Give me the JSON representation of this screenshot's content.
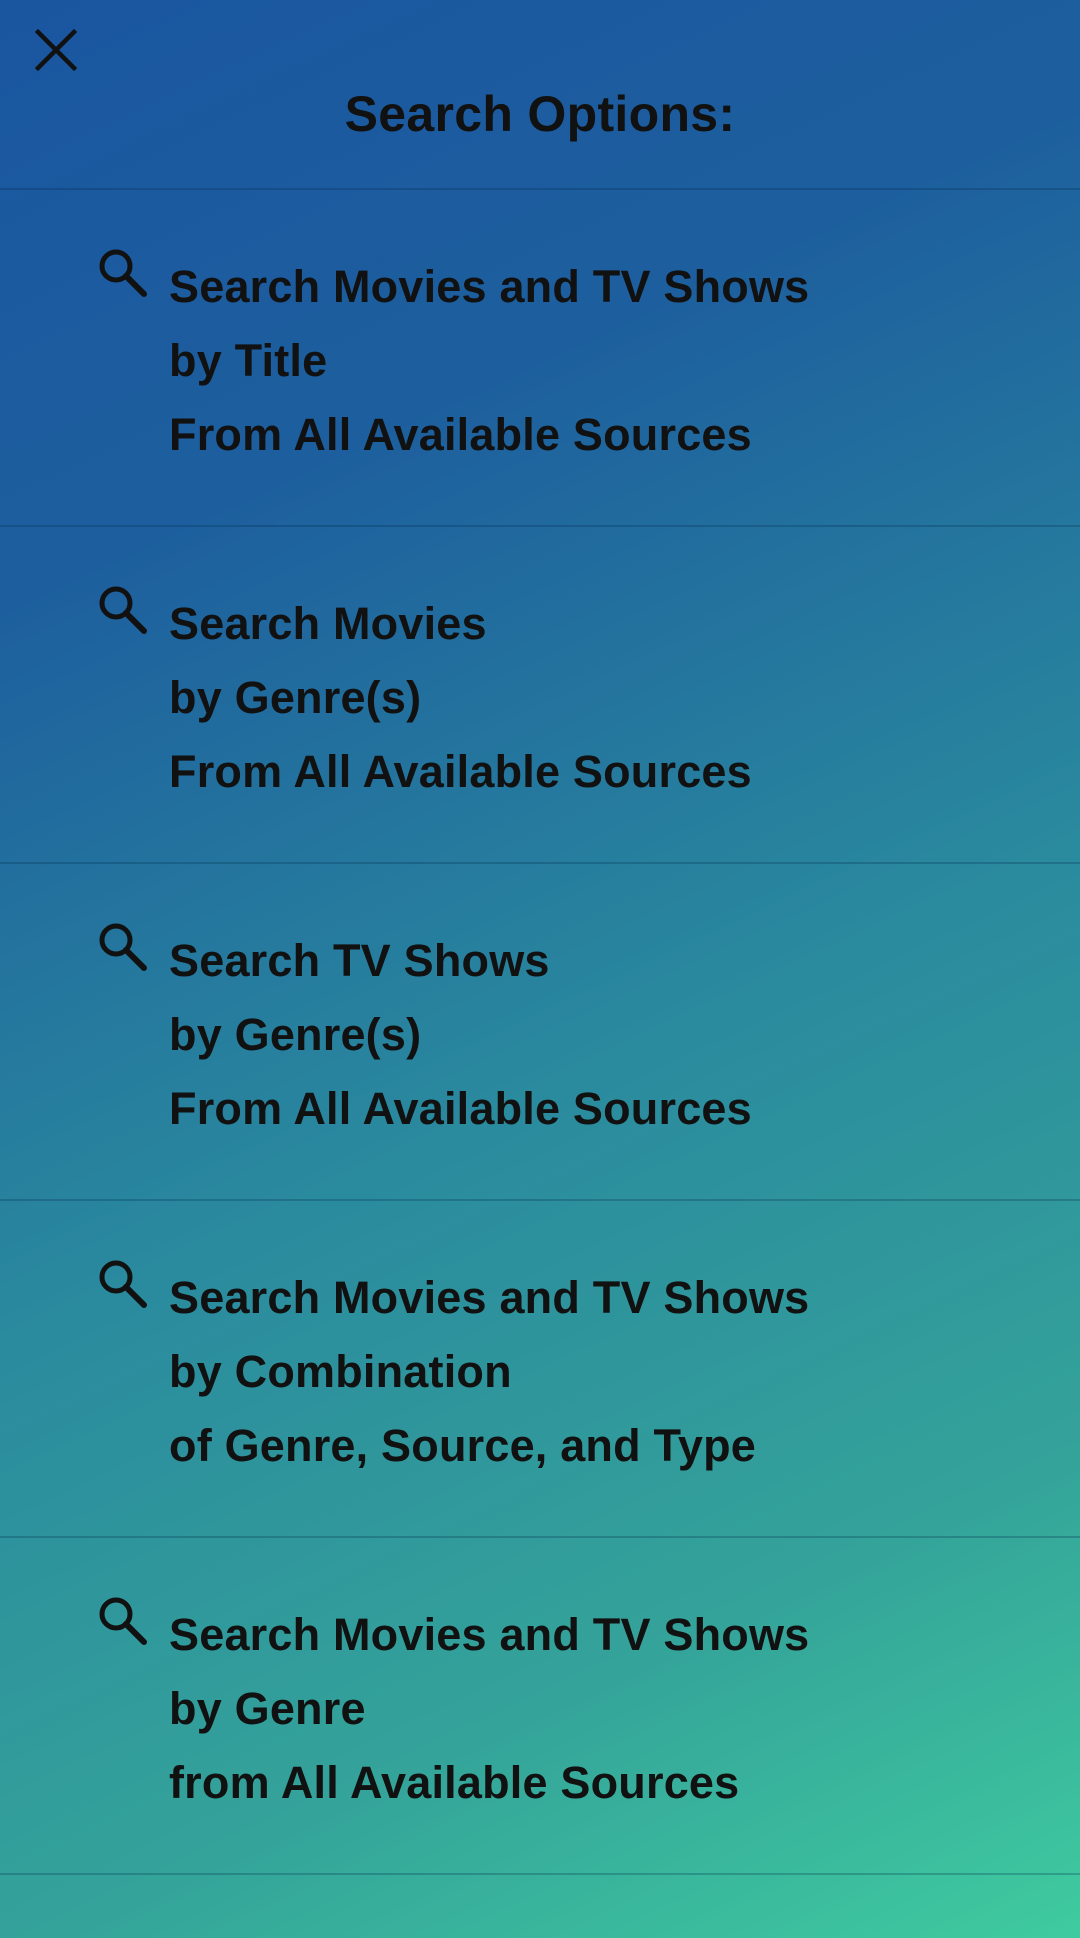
{
  "header": {
    "title": "Search Options:",
    "close_icon": "close-icon"
  },
  "options": [
    {
      "icon": "search-icon",
      "lines": [
        "Search Movies and TV Shows",
        "by Title",
        "From All Available Sources"
      ]
    },
    {
      "icon": "search-icon",
      "lines": [
        "Search Movies",
        "by Genre(s)",
        "From All Available Sources"
      ]
    },
    {
      "icon": "search-icon",
      "lines": [
        "Search TV Shows",
        "by Genre(s)",
        "From All Available Sources"
      ]
    },
    {
      "icon": "search-icon",
      "lines": [
        "Search Movies and TV Shows",
        "by Combination",
        "of Genre, Source, and Type"
      ]
    },
    {
      "icon": "search-icon",
      "lines": [
        "Search Movies and TV Shows",
        "by Genre",
        "from All Available Sources"
      ]
    }
  ],
  "colors": {
    "gradient_start": "#1a56a0",
    "gradient_end": "#3fcb9f",
    "text": "#111111"
  }
}
